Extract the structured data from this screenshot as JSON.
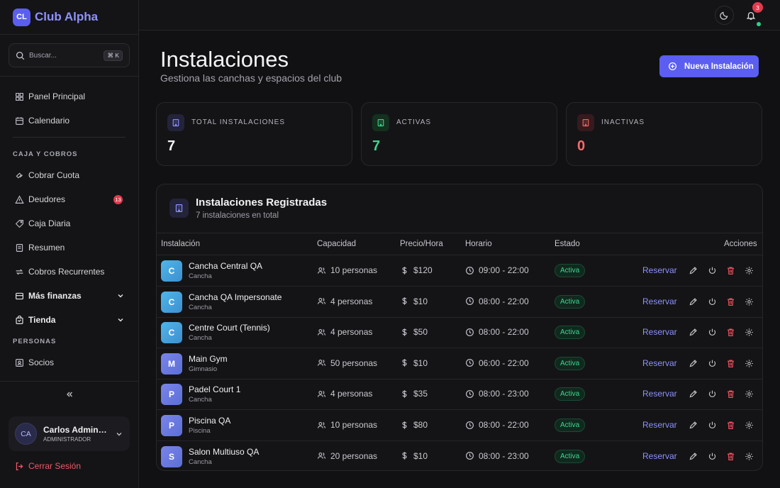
{
  "brand": {
    "logo": "CL",
    "name": "Club Alpha"
  },
  "search": {
    "placeholder": "Buscar...",
    "shortcut": "⌘ K"
  },
  "nav": {
    "top": [
      {
        "label": "Panel Principal",
        "icon": "grid-icon"
      },
      {
        "label": "Calendario",
        "icon": "calendar-icon"
      }
    ],
    "caja_section": "CAJA Y COBROS",
    "caja": [
      {
        "label": "Cobrar Cuota",
        "icon": "wallet-icon"
      },
      {
        "label": "Deudores",
        "icon": "alert-icon",
        "badge": "13"
      },
      {
        "label": "Caja Diaria",
        "icon": "tag-icon"
      },
      {
        "label": "Resumen",
        "icon": "receipt-icon"
      },
      {
        "label": "Cobros Recurrentes",
        "icon": "refresh-icon"
      }
    ],
    "groups": [
      {
        "label": "Más finanzas",
        "icon": "card-icon"
      },
      {
        "label": "Tienda",
        "icon": "bag-icon"
      }
    ],
    "personas_section": "PERSONAS",
    "personas": [
      {
        "label": "Socios",
        "icon": "id-icon"
      }
    ]
  },
  "user": {
    "initials": "CA",
    "name": "Carlos Administrador",
    "role": "ADMINISTRADOR"
  },
  "logout_label": "Cerrar Sesión",
  "topbar": {
    "notifications": "3"
  },
  "page": {
    "title": "Instalaciones",
    "subtitle": "Gestiona las canchas y espacios del club",
    "new_button": "Nueva Instalación"
  },
  "stats": [
    {
      "label": "TOTAL INSTALACIONES",
      "value": "7",
      "color": "#f4f4f6",
      "icon_bg": "#23233a",
      "icon_color": "#8e91ff"
    },
    {
      "label": "ACTIVAS",
      "value": "7",
      "color": "#3ed68e",
      "icon_bg": "#14301f",
      "icon_color": "#3ed68e"
    },
    {
      "label": "INACTIVAS",
      "value": "0",
      "color": "#f26b6b",
      "icon_bg": "#361a1e",
      "icon_color": "#f26b6b"
    }
  ],
  "table": {
    "title": "Instalaciones Registradas",
    "subtitle": "7 instalaciones en total",
    "headers": {
      "instalacion": "Instalación",
      "capacidad": "Capacidad",
      "precio": "Precio/Hora",
      "horario": "Horario",
      "estado": "Estado",
      "acciones": "Acciones"
    },
    "reserve_label": "Reservar",
    "rows": [
      {
        "initial": "C",
        "name": "Cancha Central QA",
        "type": "Cancha",
        "capacity": "10 personas",
        "price": "$120",
        "schedule": "09:00 - 22:00",
        "status": "Activa"
      },
      {
        "initial": "C",
        "name": "Cancha QA Impersonate",
        "type": "Cancha",
        "capacity": "4 personas",
        "price": "$10",
        "schedule": "08:00 - 22:00",
        "status": "Activa"
      },
      {
        "initial": "C",
        "name": "Centre Court (Tennis)",
        "type": "Cancha",
        "capacity": "4 personas",
        "price": "$50",
        "schedule": "08:00 - 22:00",
        "status": "Activa"
      },
      {
        "initial": "M",
        "name": "Main Gym",
        "type": "Gimnasio",
        "capacity": "50 personas",
        "price": "$10",
        "schedule": "06:00 - 22:00",
        "status": "Activa"
      },
      {
        "initial": "P",
        "name": "Padel Court 1",
        "type": "Cancha",
        "capacity": "4 personas",
        "price": "$35",
        "schedule": "08:00 - 23:00",
        "status": "Activa"
      },
      {
        "initial": "P",
        "name": "Piscina QA",
        "type": "Piscina",
        "capacity": "10 personas",
        "price": "$80",
        "schedule": "08:00 - 22:00",
        "status": "Activa"
      },
      {
        "initial": "S",
        "name": "Salon Multiuso QA",
        "type": "Cancha",
        "capacity": "20 personas",
        "price": "$10",
        "schedule": "08:00 - 23:00",
        "status": "Activa"
      }
    ]
  }
}
